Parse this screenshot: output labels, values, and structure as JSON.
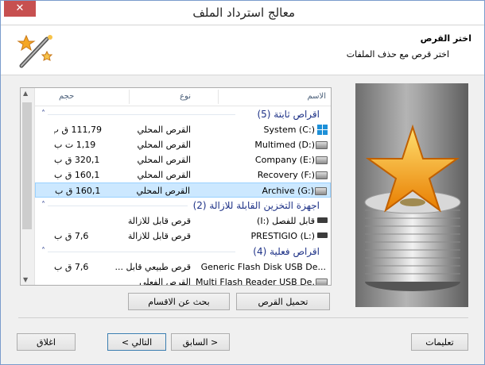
{
  "window": {
    "title": "معالج استرداد الملف"
  },
  "header": {
    "title": "اختر القرص",
    "subtitle": "اختر قرص مع حذف الملفات"
  },
  "columns": {
    "name": "الاسم",
    "type": "نوع",
    "size": "حجم"
  },
  "groups": [
    {
      "label": "اقراص ثابتة (5)"
    },
    {
      "label": "اجهزة التخزين القابلة للازالة (2)"
    },
    {
      "label": "اقراص فعلية (4)"
    }
  ],
  "fixed_drives": [
    {
      "name": "System (C:)",
      "type": "القرص المحلي",
      "size": "111,79 ق ب",
      "icon": "windows-icon"
    },
    {
      "name": "Multimed (D:)",
      "type": "القرص المحلي",
      "size": "1,19 ت ب",
      "icon": "drive-icon"
    },
    {
      "name": "Company (E:)",
      "type": "القرص المحلي",
      "size": "320,1 ق ب",
      "icon": "drive-icon"
    },
    {
      "name": "Recovery (F:)",
      "type": "القرص المحلي",
      "size": "160,1 ق ب",
      "icon": "drive-icon"
    },
    {
      "name": "Archive (G:)",
      "type": "القرص المحلي",
      "size": "160,1 ق ب",
      "icon": "drive-icon",
      "selected": true
    }
  ],
  "removable_drives": [
    {
      "name": "(I:) قابل للفصل",
      "type": "قرص قابل للازالة",
      "size": "",
      "icon": "usb-drive-icon"
    },
    {
      "name": "PRESTIGIO (L:)",
      "type": "قرص قابل للازالة",
      "size": "7,6 ق ب",
      "icon": "usb-drive-icon"
    }
  ],
  "physical_drives": [
    {
      "name": "Generic Flash Disk USB De...",
      "type": "قرص طبيعي قابل ...",
      "size": "7,6 ق ب",
      "icon": "none"
    },
    {
      "name": "Multi Flash Reader USB De...",
      "type": "القرص الفعلي",
      "size": "",
      "icon": "drive-icon"
    }
  ],
  "buttons": {
    "mount": "تحميل القرص",
    "find_partitions": "بحث عن الاقسام",
    "help": "تعليمات",
    "back": "< السابق",
    "next": "التالي >",
    "close": "اغلاق"
  },
  "colors": {
    "group_text": "#1e3287",
    "selection": "#cce8ff",
    "close_button": "#c75050"
  }
}
